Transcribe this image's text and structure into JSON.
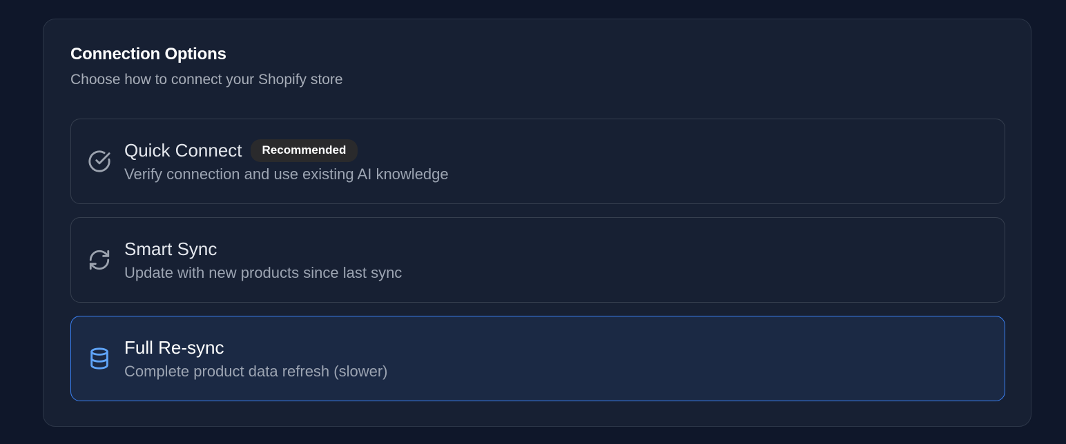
{
  "panel": {
    "title": "Connection Options",
    "subtitle": "Choose how to connect your Shopify store"
  },
  "options": [
    {
      "title": "Quick Connect",
      "badge": "Recommended",
      "description": "Verify connection and use existing AI knowledge",
      "icon": "circle-check-icon",
      "selected": false
    },
    {
      "title": "Smart Sync",
      "description": "Update with new products since last sync",
      "icon": "refresh-icon",
      "selected": false
    },
    {
      "title": "Full Re-sync",
      "description": "Complete product data refresh (slower)",
      "icon": "database-icon",
      "selected": true
    }
  ],
  "colors": {
    "background": "#0f172a",
    "card": "#172033",
    "selected_border": "#3b82f6",
    "selected_background": "#1b2944",
    "selected_icon": "#60a5fa",
    "icon": "#9ca3af"
  }
}
